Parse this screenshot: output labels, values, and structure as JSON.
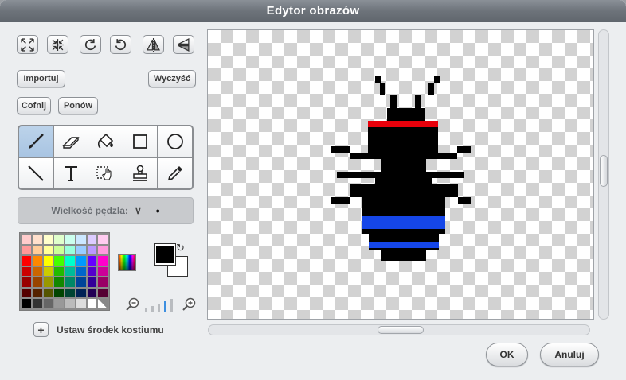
{
  "window": {
    "title": "Edytor obrazów"
  },
  "top_icons": [
    "grow-icon",
    "shrink-icon",
    "rotate-left-icon",
    "rotate-right-icon",
    "flip-horizontal-icon",
    "flip-vertical-icon"
  ],
  "buttons": {
    "import": "Importuj",
    "clear": "Wyczyść",
    "undo": "Cofnij",
    "redo": "Ponów",
    "ok": "OK",
    "cancel": "Anuluj"
  },
  "tools": [
    "paintbrush-icon",
    "eraser-icon",
    "fill-bucket-icon",
    "rectangle-icon",
    "ellipse-icon",
    "line-icon",
    "text-icon",
    "select-icon",
    "stamp-icon",
    "eyedropper-icon"
  ],
  "selected_tool": "paintbrush-icon",
  "brush": {
    "label": "Wielkość pędzla:",
    "arrow": "∨",
    "dot": "•"
  },
  "palette": [
    "#ffcccc",
    "#ffe0cc",
    "#ffffcc",
    "#e0ffcc",
    "#ccffee",
    "#cce8ff",
    "#ddccff",
    "#ffccf0",
    "#ff9999",
    "#ffcc99",
    "#ffff99",
    "#ccff99",
    "#99ffdd",
    "#99ccff",
    "#bb99ff",
    "#ff99dd",
    "#ff0000",
    "#ff8800",
    "#ffff00",
    "#44ff00",
    "#00ffcc",
    "#0099ff",
    "#6600ff",
    "#ff00cc",
    "#cc0000",
    "#cc6600",
    "#cccc00",
    "#22bb00",
    "#00bb99",
    "#0066cc",
    "#5500cc",
    "#cc0099",
    "#990000",
    "#994400",
    "#999900",
    "#118800",
    "#008866",
    "#004499",
    "#330099",
    "#990066",
    "#550000",
    "#552200",
    "#555500",
    "#004400",
    "#004433",
    "#002255",
    "#220055",
    "#550033",
    "#000000",
    "#333333",
    "#666666",
    "#999999",
    "#bbbbbb",
    "#dddddd",
    "#ffffff",
    "checker"
  ],
  "colors": {
    "foreground": "#000000",
    "background": "#ffffff",
    "swap": "↻"
  },
  "zoom": {
    "minus_icon": "zoom-out-icon",
    "plus_icon": "zoom-in-icon",
    "level": 4,
    "levels": 5
  },
  "costume_center": {
    "plus": "+",
    "label": "Ustaw środek kostiumu"
  }
}
